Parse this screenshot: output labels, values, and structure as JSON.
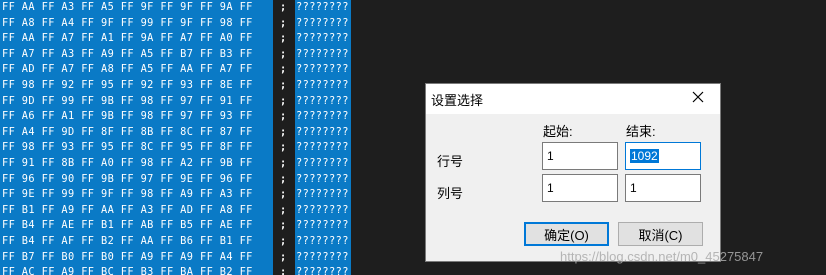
{
  "hex_lines": [
    "FF AA FF A3 FF A5 FF 9F FF 9F FF 9A FF",
    "FF A8 FF A4 FF 9F FF 99 FF 9F FF 98 FF",
    "FF AA FF A7 FF A1 FF 9A FF A7 FF A0 FF",
    "FF A7 FF A3 FF A9 FF A5 FF B7 FF B3 FF",
    "FF AD FF A7 FF A8 FF A5 FF AA FF A7 FF",
    "FF 98 FF 92 FF 95 FF 92 FF 93 FF 8E FF",
    "FF 9D FF 99 FF 9B FF 98 FF 97 FF 91 FF",
    "FF A6 FF A1 FF 9B FF 98 FF 97 FF 93 FF",
    "FF A4 FF 9D FF 8F FF 8B FF 8C FF 87 FF",
    "FF 98 FF 93 FF 95 FF 8C FF 95 FF 8F FF",
    "FF 91 FF 8B FF A0 FF 98 FF A2 FF 9B FF",
    "FF 96 FF 90 FF 9B FF 97 FF 9E FF 96 FF",
    "FF 9E FF 99 FF 9F FF 98 FF A9 FF A3 FF",
    "FF B1 FF A9 FF AA FF A3 FF AD FF A8 FF",
    "FF B4 FF AE FF B1 FF AB FF B5 FF AE FF",
    "FF B4 FF AF FF B2 FF AA FF B6 FF B1 FF",
    "FF B7 FF B0 FF B0 FF A9 FF A9 FF A4 FF",
    "FF AC FF A9 FF BC FF B3 FF BA FF B2 FF"
  ],
  "separator_char": ";",
  "ascii_text": "????????",
  "dialog": {
    "title": "设置选择",
    "close_glyph": "✕",
    "col_start": "起始:",
    "col_end": "结束:",
    "row_label": "行号",
    "col_label": "列号",
    "row_start_value": "1",
    "row_end_value": "1092",
    "col_start_value": "1",
    "col_end_value": "1",
    "ok_label": "确定(O)",
    "cancel_label": "取消(C)"
  },
  "watermark": "https://blog.csdn.net/m0_45275847",
  "colors": {
    "hex_background": "#0a7ac6",
    "editor_background": "#1e1e1e",
    "selection": "#0078d7"
  }
}
